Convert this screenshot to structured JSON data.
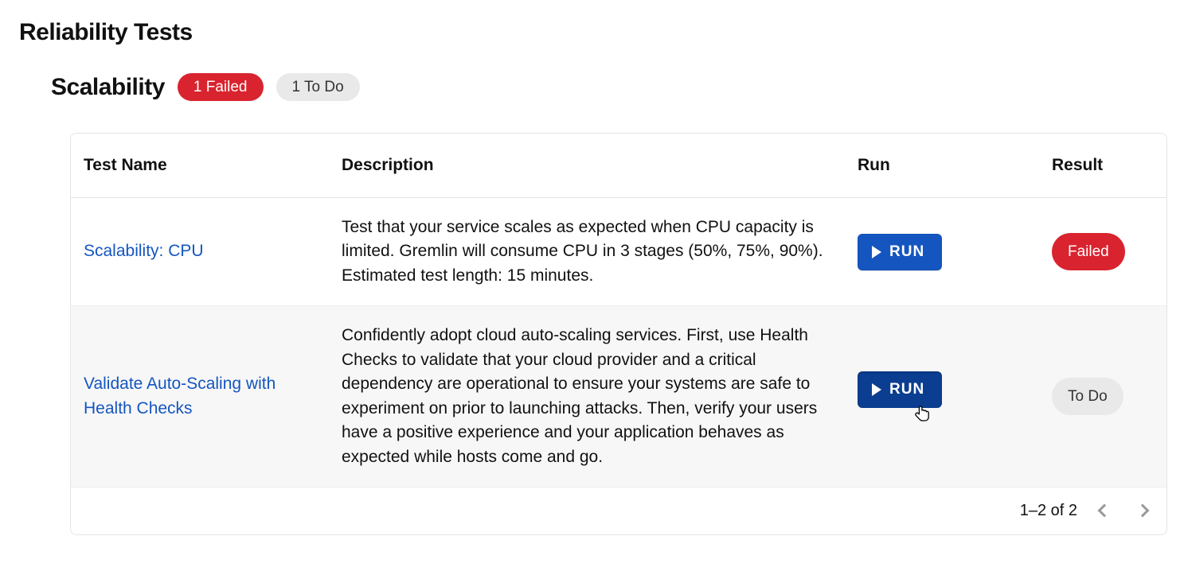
{
  "page": {
    "title": "Reliability Tests"
  },
  "section": {
    "title": "Scalability",
    "badges": {
      "failed": "1 Failed",
      "todo": "1 To Do"
    }
  },
  "columns": {
    "name": "Test Name",
    "description": "Description",
    "run": "Run",
    "result": "Result"
  },
  "rows": [
    {
      "name": "Scalability: CPU",
      "description": "Test that your service scales as expected when CPU capacity is limited. Gremlin will consume CPU in 3 stages (50%, 75%, 90%). Estimated test length: 15 minutes.",
      "run_label": "RUN",
      "result": "Failed",
      "result_kind": "failed"
    },
    {
      "name": "Validate Auto-Scaling with Health Checks",
      "description": "Confidently adopt cloud auto-scaling services. First, use Health Checks to validate that your cloud provider and a critical dependency are operational to ensure your systems are safe to experiment on prior to launching attacks. Then, verify your users have a positive experience and your application behaves as expected while hosts come and go.",
      "run_label": "RUN",
      "result": "To Do",
      "result_kind": "todo"
    }
  ],
  "pagination": {
    "label": "1–2 of 2"
  }
}
